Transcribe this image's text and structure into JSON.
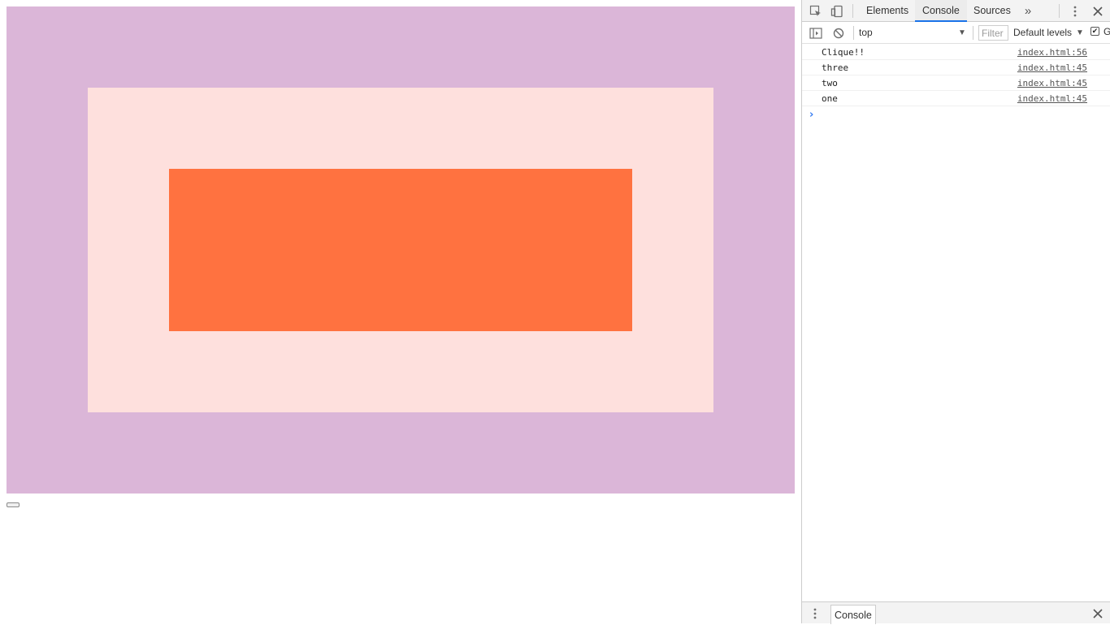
{
  "page": {
    "colors": {
      "one": "#dbb6d8",
      "two": "#fee0dd",
      "three": "#ff7240"
    }
  },
  "devtools": {
    "tabs": [
      {
        "label": "Elements",
        "active": false
      },
      {
        "label": "Console",
        "active": true
      },
      {
        "label": "Sources",
        "active": false
      }
    ],
    "more_tabs_icon": "chevron-double-right",
    "toolbar": {
      "context": "top",
      "filter_placeholder": "Filter",
      "levels": "Default levels",
      "group_checkbox_checked": true,
      "group_label": "G"
    },
    "console": {
      "entries": [
        {
          "message": "Clique!!",
          "source": "index.html:56"
        },
        {
          "message": "three",
          "source": "index.html:45"
        },
        {
          "message": "two",
          "source": "index.html:45"
        },
        {
          "message": "one",
          "source": "index.html:45"
        }
      ]
    },
    "drawer": {
      "tab_label": "Console"
    },
    "accent_color": "#1a73e8"
  }
}
